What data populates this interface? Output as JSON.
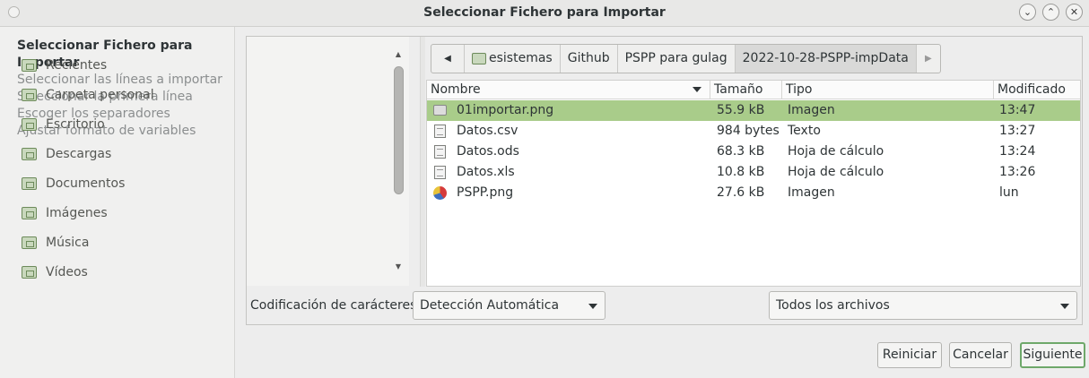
{
  "window": {
    "title": "Seleccionar Fichero para Importar"
  },
  "steps": [
    {
      "label": "Seleccionar Fichero para Importar",
      "active": true
    },
    {
      "label": "Seleccionar las líneas a importar",
      "active": false
    },
    {
      "label": "Seleccionar la primera línea",
      "active": false
    },
    {
      "label": "Escoger los separadores",
      "active": false
    },
    {
      "label": "Ajustar formato de variables",
      "active": false
    }
  ],
  "places": [
    {
      "label": "Recientes",
      "icon": "recent-icon"
    },
    {
      "label": "Carpeta personal",
      "icon": "home-folder-icon"
    },
    {
      "label": "Escritorio",
      "icon": "desktop-folder-icon"
    },
    {
      "label": "Descargas",
      "icon": "downloads-folder-icon"
    },
    {
      "label": "Documentos",
      "icon": "documents-folder-icon"
    },
    {
      "label": "Imágenes",
      "icon": "pictures-folder-icon"
    },
    {
      "label": "Música",
      "icon": "music-folder-icon"
    },
    {
      "label": "Vídeos",
      "icon": "videos-folder-icon"
    }
  ],
  "pathbar": {
    "segments": [
      "esistemas",
      "Github",
      "PSPP para gulag",
      "2022-10-28-PSPP-impData"
    ],
    "current_index": 3
  },
  "filelist": {
    "columns": [
      "Nombre",
      "Tamaño",
      "Tipo",
      "Modificado"
    ],
    "rows": [
      {
        "name": "01importar.png",
        "size": "55.9 kB",
        "type": "Imagen",
        "modified": "13:47",
        "icon": "image-file-icon",
        "selected": true
      },
      {
        "name": "Datos.csv",
        "size": "984 bytes",
        "type": "Texto",
        "modified": "13:27",
        "icon": "text-file-icon",
        "selected": false
      },
      {
        "name": "Datos.ods",
        "size": "68.3 kB",
        "type": "Hoja de cálculo",
        "modified": "13:24",
        "icon": "text-file-icon",
        "selected": false
      },
      {
        "name": "Datos.xls",
        "size": "10.8 kB",
        "type": "Hoja de cálculo",
        "modified": "13:26",
        "icon": "text-file-icon",
        "selected": false
      },
      {
        "name": "PSPP.png",
        "size": "27.6 kB",
        "type": "Imagen",
        "modified": "lun",
        "icon": "pspp-image-icon",
        "selected": false
      }
    ]
  },
  "encoding": {
    "label": "Codificación de carácteres:",
    "value": "Detección Automática"
  },
  "filter": {
    "value": "Todos los archivos"
  },
  "buttons": {
    "reset": "Reiniciar",
    "cancel": "Cancelar",
    "next": "Siguiente"
  },
  "colors": {
    "selection": "#a9cc8a",
    "accent": "#6ea86a"
  }
}
